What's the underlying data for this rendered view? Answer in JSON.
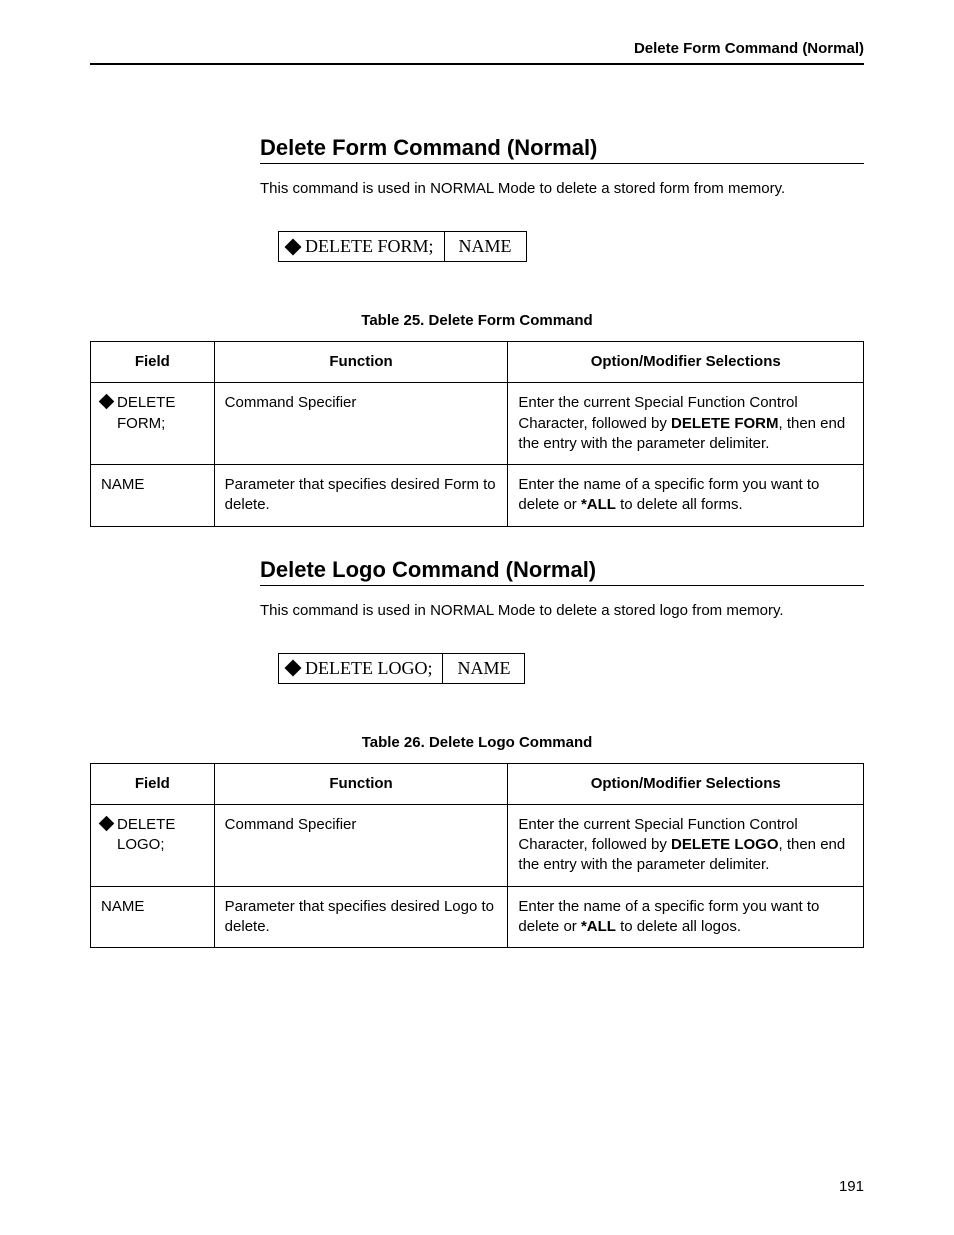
{
  "header": {
    "title": "Delete Form Command (Normal)"
  },
  "page_number": "191",
  "sections": [
    {
      "heading": "Delete Form Command (Normal)",
      "intro": "This command is used in NORMAL Mode to delete a stored form from memory.",
      "syntax": {
        "left": "DELETE FORM;",
        "right": "NAME"
      },
      "caption": "Table 25. Delete Form Command",
      "cols": {
        "field": "Field",
        "function": "Function",
        "options": "Option/Modifier Selections"
      },
      "rows": [
        {
          "field": "DELETE FORM;",
          "field_has_diamond": true,
          "function": "Command Specifier",
          "opt_pre": "Enter the current Special Function Control Character, followed by ",
          "opt_bold": "DELETE FORM",
          "opt_post": ", then end the entry with the parameter delimiter."
        },
        {
          "field": "NAME",
          "field_has_diamond": false,
          "function": "Parameter that specifies desired Form to delete.",
          "opt_pre": "Enter the name of a specific form you want to delete or ",
          "opt_bold": "*ALL",
          "opt_post": " to delete all forms."
        }
      ]
    },
    {
      "heading": "Delete Logo Command (Normal)",
      "intro": "This command is used in NORMAL Mode to delete a stored logo from memory.",
      "syntax": {
        "left": "DELETE LOGO;",
        "right": "NAME"
      },
      "caption": "Table 26. Delete Logo Command",
      "cols": {
        "field": "Field",
        "function": "Function",
        "options": "Option/Modifier Selections"
      },
      "rows": [
        {
          "field": "DELETE LOGO;",
          "field_has_diamond": true,
          "function": "Command Specifier",
          "opt_pre": "Enter the current Special Function Control Character, followed by ",
          "opt_bold": "DELETE LOGO",
          "opt_post": ", then end the entry with the parameter delimiter."
        },
        {
          "field": "NAME",
          "field_has_diamond": false,
          "function": "Parameter that specifies desired Logo to delete.",
          "opt_pre": "Enter the name of a specific form you want to delete or ",
          "opt_bold": "*ALL",
          "opt_post": " to delete all logos."
        }
      ]
    }
  ]
}
